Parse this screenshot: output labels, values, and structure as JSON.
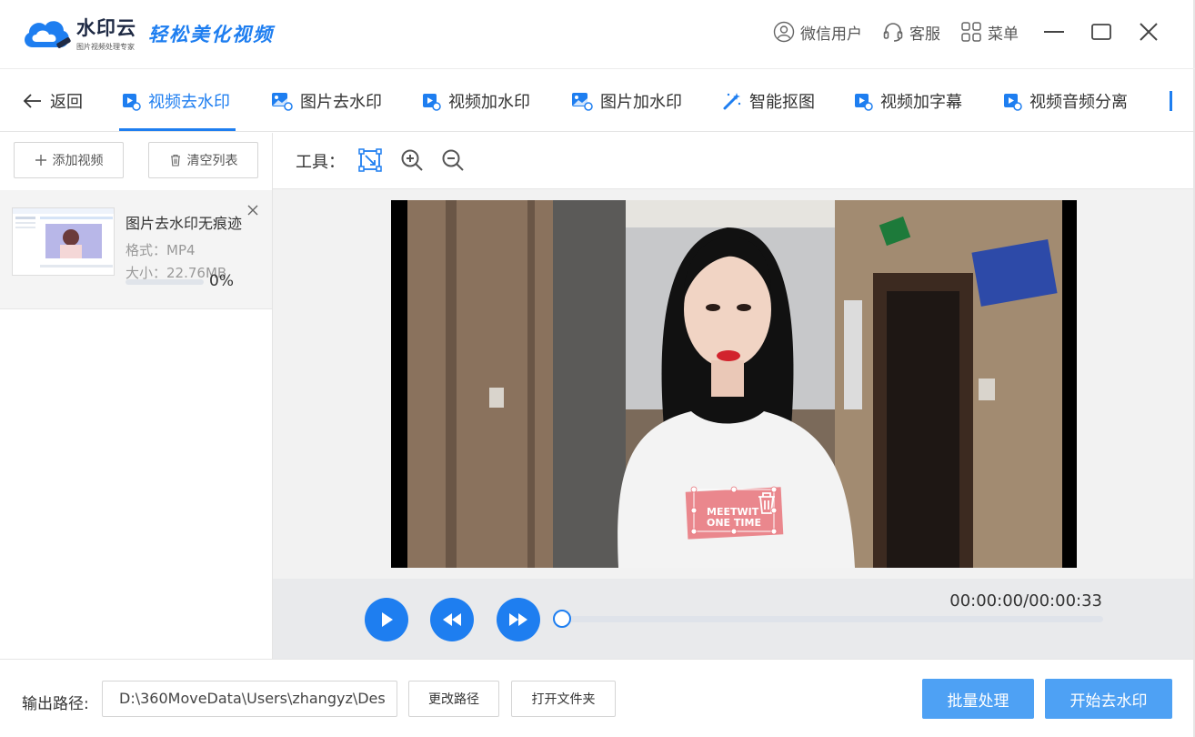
{
  "app": {
    "logo_name": "水印云",
    "logo_sub": "图片视频处理专家",
    "slogan": "轻松美化视频"
  },
  "topbar": {
    "user": "微信用户",
    "service": "客服",
    "menu": "菜单"
  },
  "nav": {
    "back": "返回",
    "tabs": [
      {
        "label": "视频去水印",
        "icon": "video-icon",
        "active": true
      },
      {
        "label": "图片去水印",
        "icon": "image-icon"
      },
      {
        "label": "视频加水印",
        "icon": "video-icon"
      },
      {
        "label": "图片加水印",
        "icon": "image-icon"
      },
      {
        "label": "智能抠图",
        "icon": "magic-wand-icon"
      },
      {
        "label": "视频加字幕",
        "icon": "video-icon"
      },
      {
        "label": "视频音频分离",
        "icon": "video-icon"
      }
    ]
  },
  "sidebar": {
    "add_label": "添加视频",
    "clear_label": "清空列表",
    "file": {
      "name": "图片去水印无痕迹",
      "format": "格式：MP4",
      "size": "大小：22.76MB",
      "progress_pct": "0%",
      "progress": 0
    }
  },
  "toolbar": {
    "label": "工具："
  },
  "player": {
    "timecode": "00:00:00/00:00:33",
    "position": 0,
    "watermark_text_1": "MEETWIT",
    "watermark_text_2": "ONE TIME"
  },
  "output": {
    "label": "输出路径:",
    "path": "D:\\360MoveData\\Users\\zhangyz\\Des",
    "change_label": "更改路径",
    "open_label": "打开文件夹",
    "batch_label": "批量处理",
    "start_label": "开始去水印"
  },
  "colors": {
    "accent": "#1e7ef0",
    "primary_button": "#4ea1f4"
  }
}
